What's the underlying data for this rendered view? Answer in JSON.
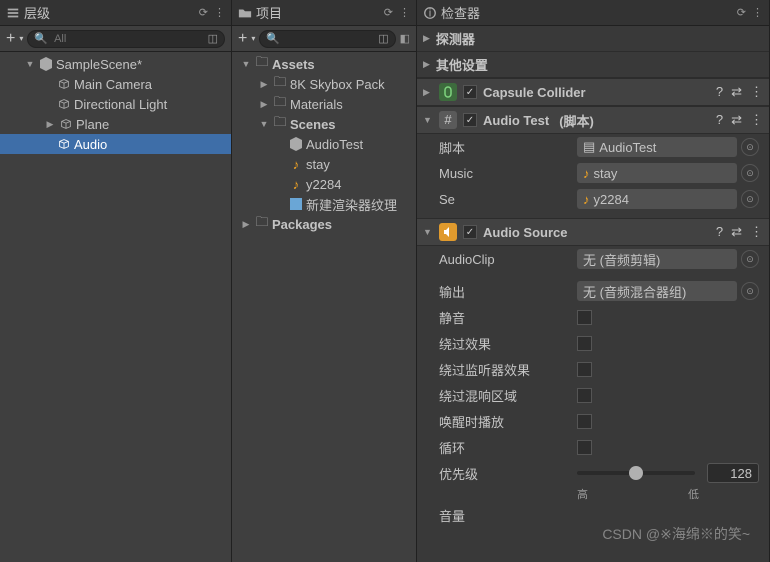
{
  "hierarchy": {
    "title": "层级",
    "search_placeholder": "All",
    "scene": "SampleScene*",
    "items": [
      "Main Camera",
      "Directional Light",
      "Plane",
      "Audio"
    ]
  },
  "project": {
    "title": "项目",
    "search_placeholder": "",
    "root": "Assets",
    "folders": [
      "8K Skybox Pack",
      "Materials",
      "Scenes"
    ],
    "scene_files": [
      "AudioTest"
    ],
    "audio_files": [
      "stay",
      "y2284"
    ],
    "misc_files": [
      "新建渲染器纹理"
    ],
    "packages": "Packages"
  },
  "inspector": {
    "title": "检查器",
    "collapsed": [
      "探测器",
      "其他设置"
    ],
    "capsule": {
      "title": "Capsule Collider"
    },
    "audiotest": {
      "title": "Audio Test",
      "subtitle": "(脚本)",
      "script_label": "脚本",
      "script_value": "AudioTest",
      "music_label": "Music",
      "music_value": "stay",
      "se_label": "Se",
      "se_value": "y2284"
    },
    "audiosource": {
      "title": "Audio Source",
      "audioclip_label": "AudioClip",
      "audioclip_value": "无 (音频剪辑)",
      "output_label": "输出",
      "output_value": "无 (音频混合器组)",
      "mute_label": "静音",
      "bypass_effects_label": "绕过效果",
      "bypass_listener_label": "绕过监听器效果",
      "bypass_reverb_label": "绕过混响区域",
      "play_on_awake_label": "唤醒时播放",
      "loop_label": "循环",
      "priority_label": "优先级",
      "priority_value": "128",
      "priority_high": "高",
      "priority_low": "低",
      "volume_label": "音量"
    }
  },
  "watermark": "CSDN @※海绵※的笑~"
}
